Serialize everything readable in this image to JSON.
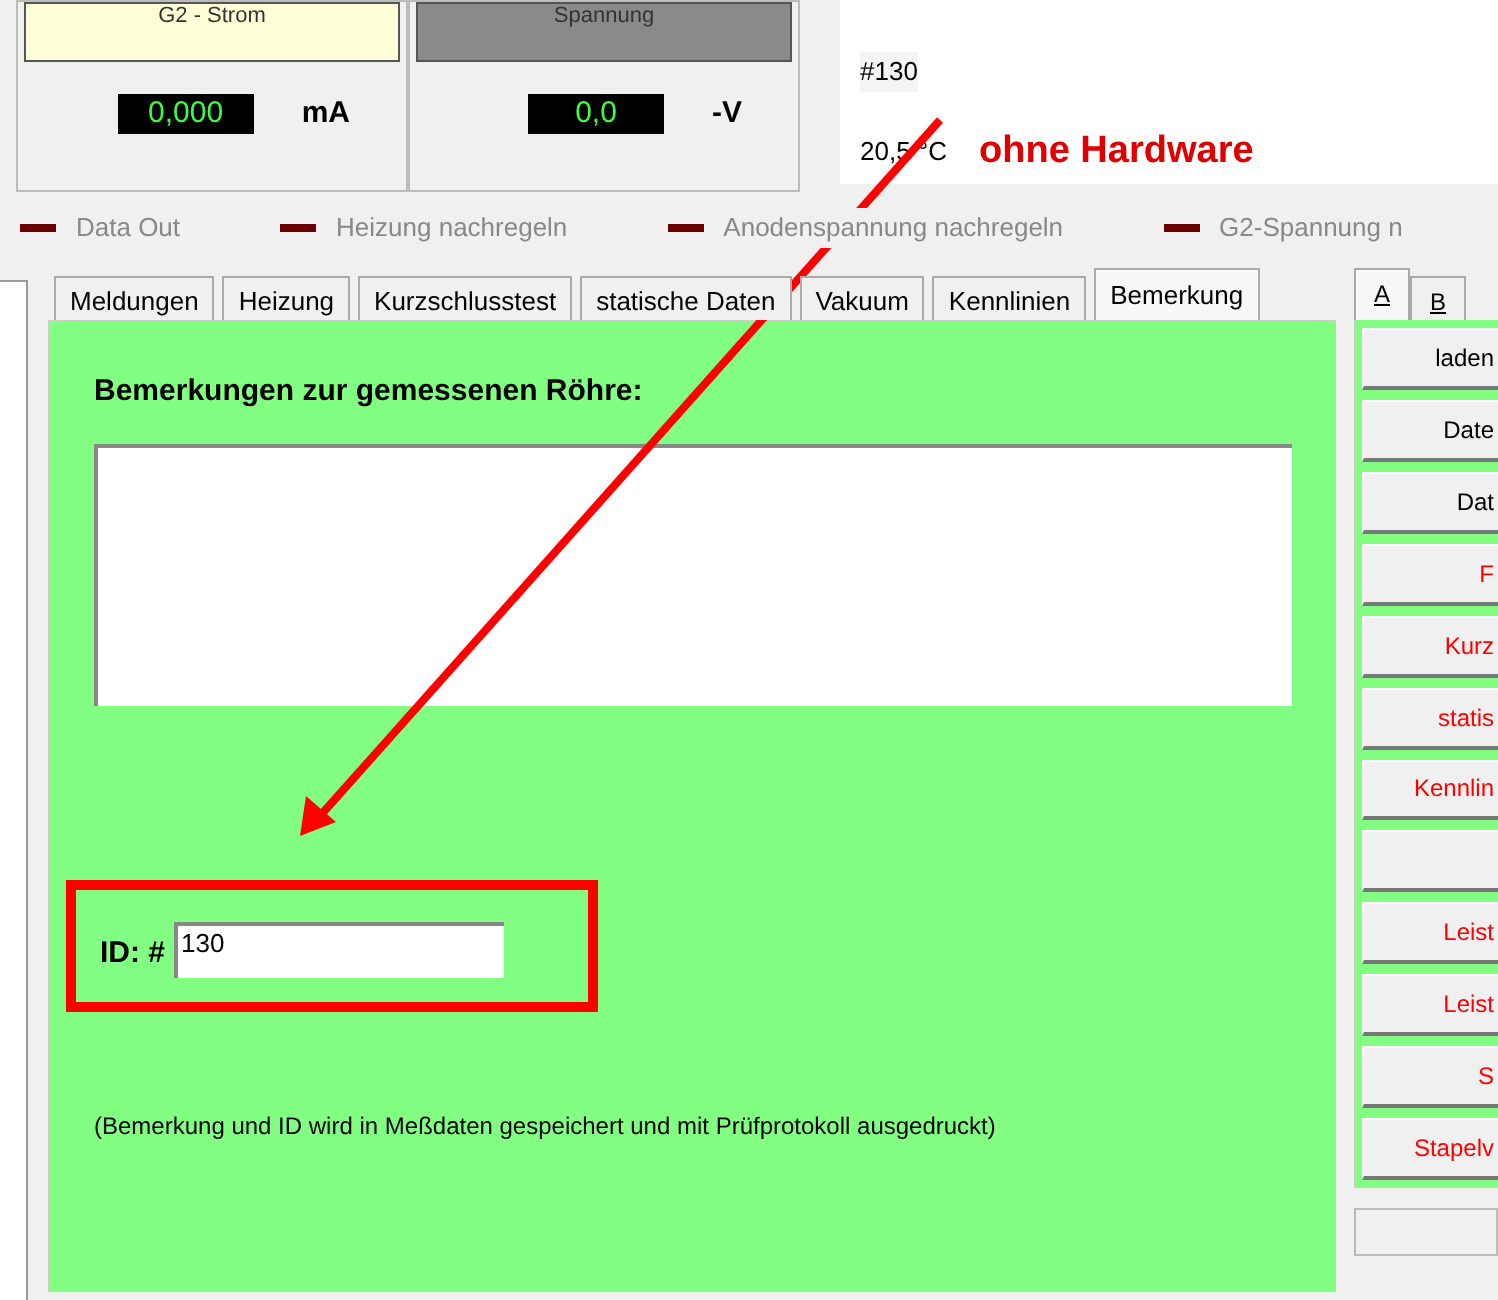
{
  "meters": [
    {
      "title": "G2 - Strom",
      "kind": "cream",
      "reading": "0,000",
      "unit": "mA"
    },
    {
      "title": "Spannung",
      "kind": "grey",
      "reading": "0,0",
      "unit": "-V"
    }
  ],
  "info": {
    "id": "#130",
    "temperature": "20,5 °C",
    "status": "ohne Hardware"
  },
  "legend": [
    {
      "label": "Data Out",
      "color": "#6b0000"
    },
    {
      "label": "Heizung nachregeln",
      "color": "#6b0000"
    },
    {
      "label": "Anodenspannung nachregeln",
      "color": "#6b0000"
    },
    {
      "label": "G2-Spannung n",
      "color": "#6b0000"
    }
  ],
  "tabs": [
    {
      "label": "Meldungen",
      "selected": false
    },
    {
      "label": "Heizung",
      "selected": false
    },
    {
      "label": "Kurzschlusstest",
      "selected": false
    },
    {
      "label": "statische Daten",
      "selected": false
    },
    {
      "label": "Vakuum",
      "selected": false
    },
    {
      "label": "Kennlinien",
      "selected": false
    },
    {
      "label": "Bemerkung",
      "selected": true
    }
  ],
  "panel": {
    "heading": "Bemerkungen zur gemessenen Röhre:",
    "id_label": "ID: #",
    "id_value": "130",
    "note": "(Bemerkung und ID wird in Meßdaten gespeichert und mit Prüfprotokoll ausgedruckt)"
  },
  "side_tabs": [
    {
      "label": "A",
      "selected": true
    },
    {
      "label": "B",
      "selected": false
    }
  ],
  "side_buttons": [
    {
      "kind": "command",
      "label": "laden",
      "color": "#000000"
    },
    {
      "kind": "command",
      "label": "Date",
      "color": "#000000"
    },
    {
      "kind": "command",
      "label": "Dat",
      "color": "#000000"
    },
    {
      "kind": "command",
      "label": "F",
      "color": "#ff0000"
    },
    {
      "kind": "command",
      "label": "Kurz",
      "color": "#ff0000"
    },
    {
      "kind": "command",
      "label": "statis",
      "color": "#ff0000"
    },
    {
      "kind": "command",
      "label": "Kennlin",
      "color": "#ff0000"
    },
    {
      "kind": "spacer"
    },
    {
      "kind": "command",
      "label": "Leist",
      "color": "#ff0000"
    },
    {
      "kind": "command",
      "label": "Leist",
      "color": "#ff0000"
    },
    {
      "kind": "command",
      "label": "S",
      "color": "#ff0000"
    },
    {
      "kind": "command",
      "label": "Stapelv",
      "color": "#ff0000"
    }
  ]
}
